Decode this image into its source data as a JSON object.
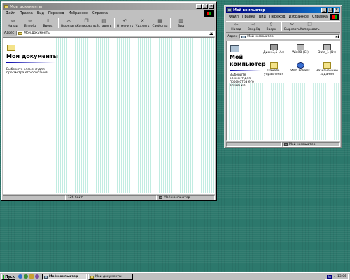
{
  "desktop": {
    "colors": {
      "background": "#2c786c",
      "active_title": "#000080",
      "inactive_title": "#808080"
    }
  },
  "window_docs": {
    "title": "Мои документы",
    "menu": [
      "Файл",
      "Правка",
      "Вид",
      "Переход",
      "Избранное",
      "Справка"
    ],
    "toolbar": [
      {
        "label": "Назад",
        "icon": "back-arrow-icon"
      },
      {
        "label": "Вперёд",
        "icon": "forward-arrow-icon"
      },
      {
        "label": "Вверх",
        "icon": "up-folder-icon"
      },
      {
        "label": "Вырезать",
        "icon": "scissors-icon"
      },
      {
        "label": "Копировать",
        "icon": "copy-icon"
      },
      {
        "label": "Вставить",
        "icon": "paste-icon"
      },
      {
        "label": "Отменить",
        "icon": "undo-icon"
      },
      {
        "label": "Удалить",
        "icon": "delete-x-icon"
      },
      {
        "label": "Свойства",
        "icon": "properties-icon"
      },
      {
        "label": "Вид",
        "icon": "views-icon"
      }
    ],
    "address_label": "Адрес",
    "address_value": "Мои документы",
    "pane_title": "Мои документы",
    "pane_desc": "Выберите элемент для просмотра его описания.",
    "status_size": "126 байт",
    "status_zone": "Мой компьютер"
  },
  "window_pc": {
    "title": "Мой компьютер",
    "menu": [
      "Файл",
      "Правка",
      "Вид",
      "Переход",
      "Избранное",
      "Справка"
    ],
    "toolbar": [
      {
        "label": "Назад",
        "icon": "back-arrow-icon"
      },
      {
        "label": "Вперёд",
        "icon": "forward-arrow-icon"
      },
      {
        "label": "Вверх",
        "icon": "up-folder-icon"
      },
      {
        "label": "Вырезать",
        "icon": "scissors-icon"
      },
      {
        "label": "Копировать",
        "icon": "copy-icon"
      }
    ],
    "address_label": "Адрес",
    "address_value": "Мой компьютер",
    "pane_title": "Мой компьютер",
    "pane_desc": "Выберите элемент для просмотра его описания.",
    "items": [
      {
        "label": "Диск 3,5 (A:)",
        "icon": "floppy-drive-icon"
      },
      {
        "label": "Win98 (C:)",
        "icon": "hard-drive-icon"
      },
      {
        "label": "Data_1 (D:)",
        "icon": "hard-drive-icon"
      },
      {
        "label": "Панель управления",
        "icon": "control-panel-icon"
      },
      {
        "label": "Web Folders",
        "icon": "web-folders-icon"
      },
      {
        "label": "Назначенные задания",
        "icon": "scheduled-tasks-icon"
      }
    ],
    "status_zone": "Мой компьютер"
  },
  "taskbar": {
    "start_label": "Пуск",
    "items": [
      {
        "label": "Мой компьютер",
        "pressed": true
      },
      {
        "label": "Мои документы",
        "pressed": false
      }
    ],
    "lang": "Ru",
    "clock": "13:06"
  }
}
